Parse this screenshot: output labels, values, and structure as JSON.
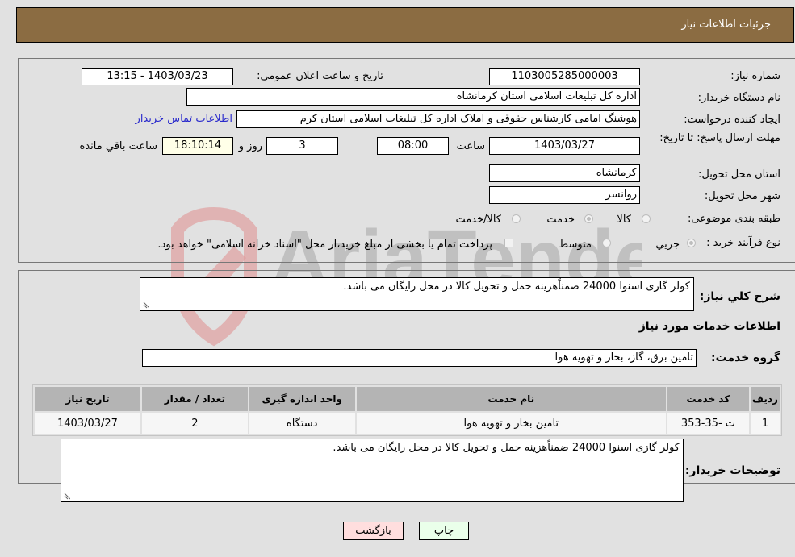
{
  "header": {
    "title": "جزئیات اطلاعات نیاز"
  },
  "form": {
    "need_number": {
      "label": "شماره نیاز:",
      "value": "1103005285000003"
    },
    "announce_datetime": {
      "label": "تاریخ و ساعت اعلان عمومی:",
      "value": "1403/03/23 - 13:15"
    },
    "buyer_org": {
      "label": "نام دستگاه خریدار:",
      "value": "اداره کل تبلیغات اسلامی استان کرمانشاه"
    },
    "requester": {
      "label": "ایجاد کننده درخواست:",
      "value": "هوشنگ  امامی کارشناس حقوقی و املاک اداره کل تبلیغات اسلامی استان کرم",
      "contact_link": "اطلاعات تماس خریدار"
    },
    "deadline": {
      "label": "مهلت ارسال پاسخ: تا تاریخ:",
      "date": "1403/03/27",
      "time_label": "ساعت",
      "time": "08:00",
      "days": "3",
      "days_label": "روز و",
      "remaining": "18:10:14",
      "remaining_label": "ساعت باقي مانده"
    },
    "province": {
      "label": "استان محل تحویل:",
      "value": "کرمانشاه"
    },
    "city": {
      "label": "شهر محل تحویل:",
      "value": "روانسر"
    },
    "category": {
      "label": "طبقه بندی موضوعی:",
      "options": [
        "کالا",
        "خدمت",
        "کالا/خدمت"
      ],
      "selected": "خدمت"
    },
    "purchase_type": {
      "label": "نوع فرآیند خرید :",
      "options": [
        "جزيي",
        "متوسط"
      ],
      "selected": "جزيي",
      "treasury_note": "پرداخت تمام یا بخشی از مبلغ خرید،از محل \"اسناد خزانه اسلامی\" خواهد بود."
    }
  },
  "details": {
    "summary_label": "شرح کلي نياز:",
    "summary": "کولر گازی اسنوا 24000 ضمناًهزینه حمل و تحویل کالا در محل رایگان می باشد.",
    "services_title": "اطلاعات خدمات مورد نیاز",
    "service_group_label": "گروه خدمت:",
    "service_group": "تامین برق، گاز، بخار و تهویه هوا",
    "table": {
      "headers": [
        "ردیف",
        "کد خدمت",
        "نام خدمت",
        "واحد اندازه گیری",
        "تعداد / مقدار",
        "تاریخ نیاز"
      ],
      "rows": [
        [
          "1",
          "ت -35-353",
          "تامین بخار و تهویه هوا",
          "دستگاه",
          "2",
          "1403/03/27"
        ]
      ]
    },
    "buyer_notes_label": "توضیحات خریدار:",
    "buyer_notes": "کولر گازی اسنوا 24000 ضمناًهزینه حمل و تحویل کالا در محل رایگان می باشد."
  },
  "buttons": {
    "print": "چاپ",
    "back": "بازگشت"
  },
  "watermark": {
    "text": "AriaTender.neT"
  },
  "colors": {
    "header_bg": "#8b6c42",
    "print_bg": "#eaffea",
    "back_bg": "#ffdede",
    "link": "#2a2acc"
  }
}
